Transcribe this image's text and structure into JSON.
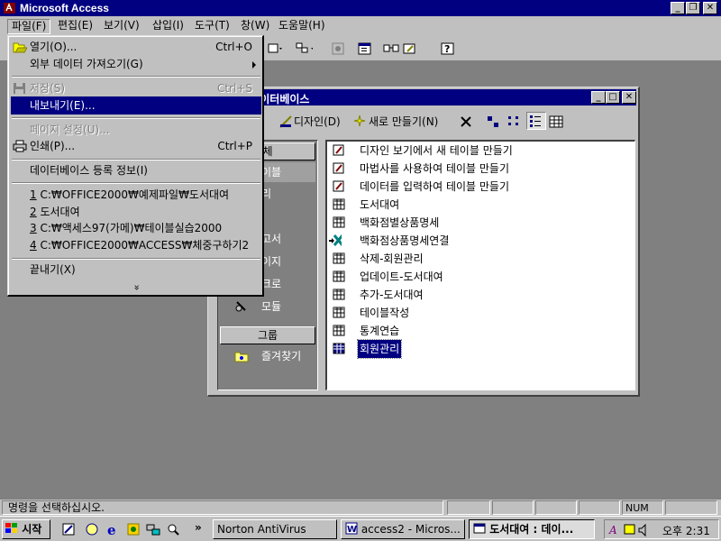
{
  "window": {
    "title": "Microsoft Access"
  },
  "menubar": {
    "items": [
      "파일(F)",
      "편집(E)",
      "보기(V)",
      "삽입(I)",
      "도구(T)",
      "창(W)",
      "도움말(H)"
    ]
  },
  "file_menu": {
    "open": {
      "label": "열기(O)...",
      "shortcut": "Ctrl+O"
    },
    "import_external": {
      "label": "외부 데이터 가져오기(G)"
    },
    "save": {
      "label": "저장(S)",
      "shortcut": "Ctrl+S"
    },
    "export": {
      "label": "내보내기(E)..."
    },
    "page_setup": {
      "label": "페이지 설정(U)..."
    },
    "print": {
      "label": "인쇄(P)...",
      "shortcut": "Ctrl+P"
    },
    "db_properties": {
      "label": "데이터베이스 등록 정보(I)"
    },
    "recent": [
      {
        "num": "1",
        "path": "C:₩OFFICE2000₩예제파일₩도서대여"
      },
      {
        "num": "2",
        "path": "도서대여"
      },
      {
        "num": "3",
        "path": "C:₩액세스97(가메)₩테이블실습2000"
      },
      {
        "num": "4",
        "path": "C:₩OFFICE2000₩ACCESS₩체중구하기2"
      }
    ],
    "exit": {
      "label": "끝내기(X)"
    },
    "more": "»"
  },
  "db_window": {
    "title": "여 : 데이터베이스",
    "toolbar": {
      "open_tail": ")",
      "design": "디자인(D)",
      "new": "새로 만들기(N)"
    },
    "objects_header": "체",
    "objects": [
      "이블",
      "리",
      "고서",
      "이지",
      "크로",
      "모듈"
    ],
    "groups_label": "그룹",
    "favorites_label": "즐겨찾기",
    "items": [
      "디자인 보기에서 새 테이블 만들기",
      "마법사를 사용하여 테이블 만들기",
      "데이터를 입력하여 테이블 만들기",
      "도서대여",
      "백화점별상품명세",
      "백화점상품명세연결",
      "삭제-회원관리",
      "업데이트-도서대여",
      "추가-도서대여",
      "테이블작성",
      "통계연습",
      "회원관리"
    ],
    "selected_item": "회원관리"
  },
  "statusbar": {
    "message": "명령을 선택하십시오.",
    "num": "NUM"
  },
  "taskbar": {
    "start": "시작",
    "more": "»",
    "tasks": [
      "Norton AntiVirus",
      "access2 - Micros...",
      "도서대여 : 데이..."
    ],
    "clock": "오후 2:31"
  }
}
